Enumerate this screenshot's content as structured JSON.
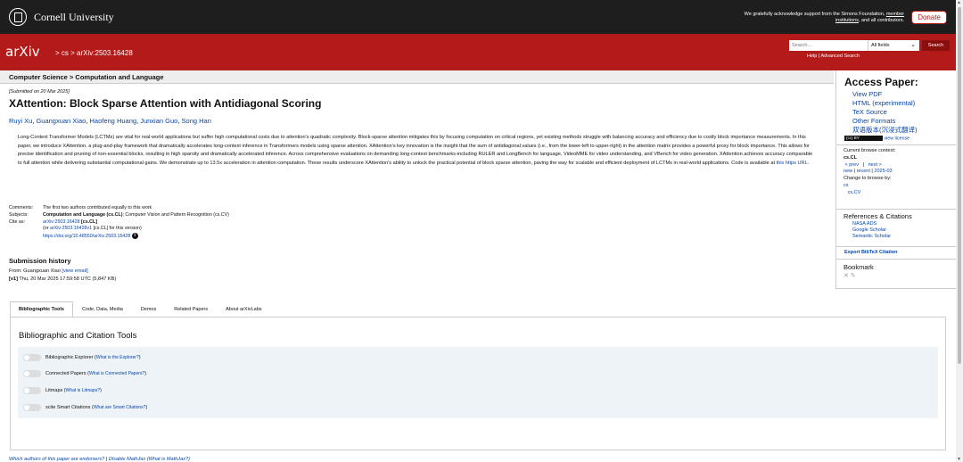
{
  "header": {
    "university": "Cornell University",
    "support_line1": "We gratefully acknowledge support from the Simons Foundation,",
    "support_link1": "member",
    "support_link2": "institutions",
    "support_line2": ", and all contributors.",
    "donate": "Donate"
  },
  "nav": {
    "logo": "arXiv",
    "breadcrumb_sep1": ">",
    "breadcrumb_cs": "cs",
    "breadcrumb_sep2": ">",
    "breadcrumb_id": "arXiv:2503.16428",
    "search_placeholder": "Search...",
    "search_field": "All fields",
    "search_button": "Search",
    "help": "Help",
    "help_sep": "|",
    "advanced": "Advanced Search"
  },
  "paper": {
    "subject_header": "Computer Science > Computation and Language",
    "submitted": "[Submitted on 20 Mar 2025]",
    "title": "XAttention: Block Sparse Attention with Antidiagonal Scoring",
    "authors": [
      "Ruyi Xu",
      "Guangxuan Xiao",
      "Haofeng Huang",
      "Junxian Guo",
      "Song Han"
    ],
    "abstract": "Long-Context Transformer Models (LCTMs) are vital for real-world applications but suffer high computational costs due to attention's quadratic complexity. Block-sparse attention mitigates this by focusing computation on critical regions, yet existing methods struggle with balancing accuracy and efficiency due to costly block importance measurements. In this paper, we introduce XAttention, a plug-and-play framework that dramatically accelerates long-context inference in Transformers models using sparse attention. XAttention's key innovation is the insight that the sum of antidiagonal values (i.e., from the lower-left to upper-right) in the attention matrix provides a powerful proxy for block importance. This allows for precise identification and pruning of non-essential blocks, resulting in high sparsity and dramatically accelerated inference. Across comprehensive evaluations on demanding long-context benchmarks-including RULER and LongBench for language, VideoMME for video understanding, and VBench for video generation. XAttention achieves accuracy comparable to full attention while delivering substantial computational gains. We demonstrate up to 13.5x acceleration in attention computation. These results underscore XAttention's ability to unlock the practical potential of block sparse attention, paving the way for scalable and efficient deployment of LCTMs in real-world applications. Code is available at",
    "abstract_link": "this https URL",
    "comments_label": "Comments:",
    "comments": "The first two authors contributed equally to this work",
    "subjects_label": "Subjects:",
    "subjects_primary": "Computation and Language (cs.CL)",
    "subjects_rest": "; Computer Vision and Pattern Recognition (cs.CV)",
    "cite_label": "Cite as:",
    "cite_id": "arXiv:2503.16428",
    "cite_cat": "[cs.CL]",
    "cite_version_pre": "(or",
    "cite_version_id": "arXiv:2503.16428v1",
    "cite_version_post": "[cs.CL] for this version)",
    "doi": "https://doi.org/10.48550/arXiv.2503.16428",
    "doi_icon": "info-icon"
  },
  "history": {
    "heading": "Submission history",
    "from_label": "From: Guangxuan Xiao",
    "view_email": "[view email]",
    "v1_label": "[v1]",
    "v1_text": "Thu, 20 Mar 2025 17:59:58 UTC (5,847 KB)"
  },
  "tabs": [
    {
      "label": "Bibliographic Tools"
    },
    {
      "label": "Code, Data, Media"
    },
    {
      "label": "Demos"
    },
    {
      "label": "Related Papers"
    },
    {
      "label": "About arXivLabs"
    }
  ],
  "tools": {
    "heading": "Bibliographic and Citation Tools",
    "items": [
      {
        "name": "Bibliographic Explorer",
        "link": "What is the Explorer?"
      },
      {
        "name": "Connected Papers",
        "link": "What is Connected Papers?"
      },
      {
        "name": "Litmaps",
        "link": "What is Litmaps?"
      },
      {
        "name": "scite Smart Citations",
        "link": "What are Smart Citations?"
      }
    ]
  },
  "footer": {
    "endorsers": "Which authors of this paper are endorsers?",
    "sep1": "|",
    "disable_mathjax": "Disable MathJax",
    "what_mathjax": "(What is MathJax?)"
  },
  "sidebar": {
    "access_heading": "Access Paper:",
    "access_links": [
      "View PDF",
      "HTML (experimental)",
      "TeX Source",
      "Other Formats",
      "双语版本(沉浸式翻译)"
    ],
    "cc_badge": "(cc) BY",
    "license": "view license",
    "browse_context_label": "Current browse context:",
    "browse_context": "cs.CL",
    "prev": "< prev",
    "browse_sep": "|",
    "next": "next >",
    "new": "new",
    "recent": "recent",
    "month": "2025-03",
    "change_browse": "Change to browse by:",
    "browse_cs": "cs",
    "browse_cscv": "cs.CV",
    "refs_heading": "References & Citations",
    "refs_links": [
      "NASA ADS",
      "Google Scholar",
      "Semantic Scholar"
    ],
    "bibtex": "Export BibTeX Citation",
    "bookmark_heading": "Bookmark",
    "bookmark_icons": "✕ ✎"
  },
  "colors": {
    "brand_red": "#b31b1b",
    "topbar_dark": "#1e1e1e",
    "link_blue": "#0645ad"
  }
}
